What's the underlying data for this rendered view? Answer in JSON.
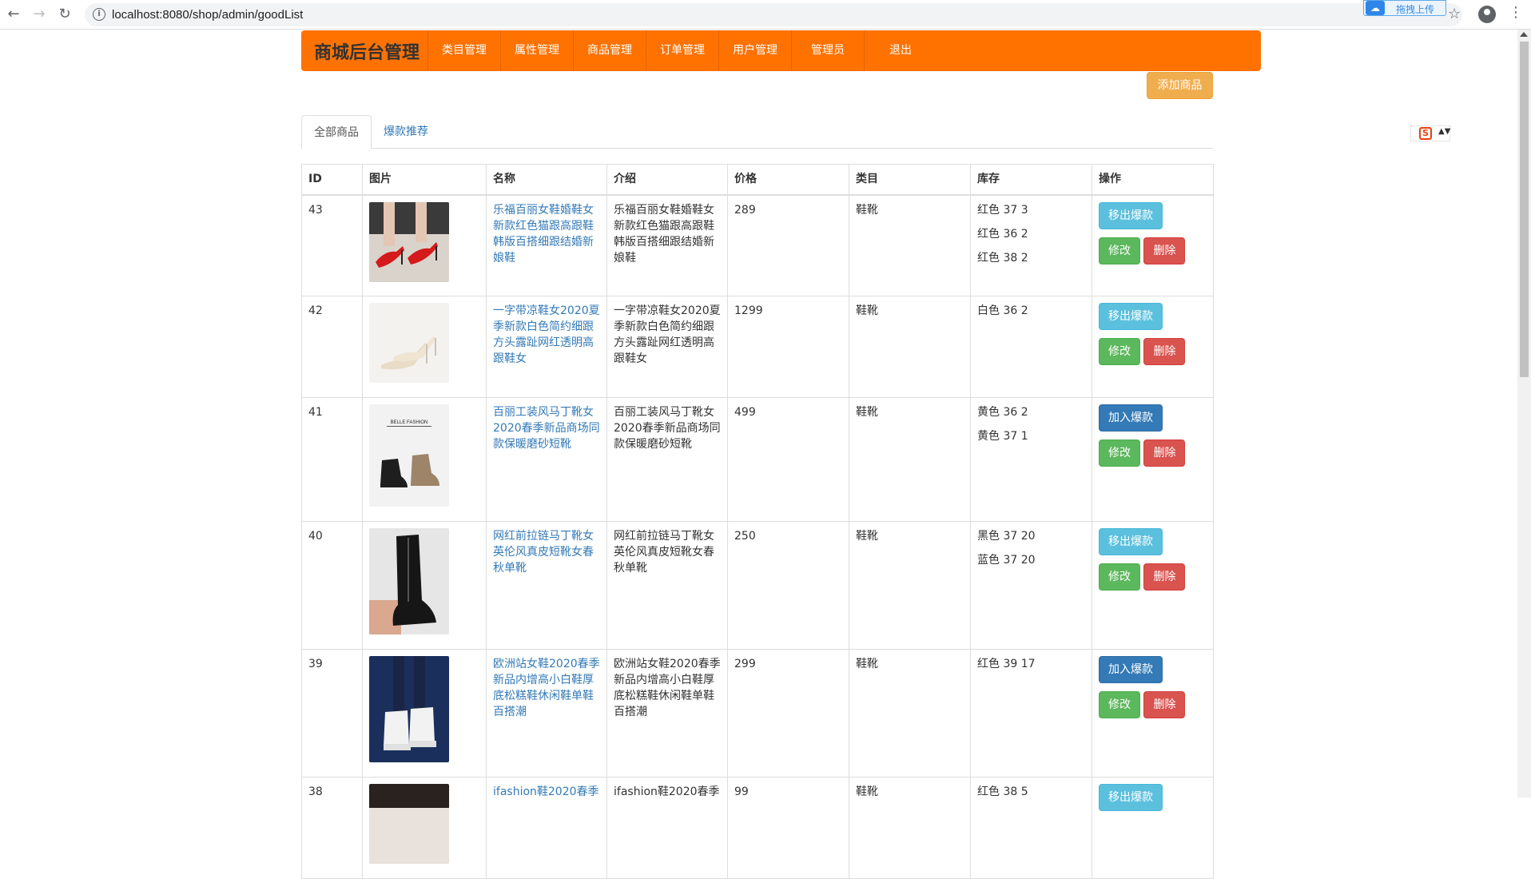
{
  "browser": {
    "url": "localhost:8080/shop/admin/goodList",
    "upload_ext_label": "拖拽上传"
  },
  "nav": {
    "brand": "商城后台管理",
    "items": [
      "类目管理",
      "属性管理",
      "商品管理",
      "订单管理",
      "用户管理",
      "管理员",
      "退出"
    ]
  },
  "add_button": "添加商品",
  "tabs": [
    "全部商品",
    "爆款推荐"
  ],
  "table": {
    "headers": [
      "ID",
      "图片",
      "名称",
      "介绍",
      "价格",
      "类目",
      "库存",
      "操作"
    ],
    "edit_label": "修改",
    "delete_label": "删除",
    "rows": [
      {
        "id": "43",
        "name": "乐福百丽女鞋婚鞋女新款红色猫跟高跟鞋韩版百搭细跟结婚新娘鞋",
        "intro": "乐福百丽女鞋婚鞋女新款红色猫跟高跟鞋韩版百搭细跟结婚新娘鞋",
        "price": "289",
        "category": "鞋靴",
        "stock": [
          "红色 37 3",
          "红色 36 2",
          "红色 38 2"
        ],
        "hot_label": "移出爆款",
        "hot_style": "info"
      },
      {
        "id": "42",
        "name": "一字带凉鞋女2020夏季新款白色简约细跟方头露趾网红透明高跟鞋女",
        "intro": "一字带凉鞋女2020夏季新款白色简约细跟方头露趾网红透明高跟鞋女",
        "price": "1299",
        "category": "鞋靴",
        "stock": [
          "白色 36 2"
        ],
        "hot_label": "移出爆款",
        "hot_style": "info"
      },
      {
        "id": "41",
        "name": "百丽工装风马丁靴女2020春季新品商场同款保暖磨砂短靴",
        "intro": "百丽工装风马丁靴女2020春季新品商场同款保暖磨砂短靴",
        "price": "499",
        "category": "鞋靴",
        "stock": [
          "黄色 36 2",
          "黄色 37 1"
        ],
        "hot_label": "加入爆款",
        "hot_style": "primary",
        "image_caption": "BELLE FASHION"
      },
      {
        "id": "40",
        "name": "网红前拉链马丁靴女英伦风真皮短靴女春秋单靴",
        "intro": "网红前拉链马丁靴女英伦风真皮短靴女春秋单靴",
        "price": "250",
        "category": "鞋靴",
        "stock": [
          "黑色 37 20",
          "蓝色 37 20"
        ],
        "hot_label": "移出爆款",
        "hot_style": "info"
      },
      {
        "id": "39",
        "name": "欧洲站女鞋2020春季新品内增高小白鞋厚底松糕鞋休闲鞋单鞋百搭潮",
        "intro": "欧洲站女鞋2020春季新品内增高小白鞋厚底松糕鞋休闲鞋单鞋百搭潮",
        "price": "299",
        "category": "鞋靴",
        "stock": [
          "红色 39 17"
        ],
        "hot_label": "加入爆款",
        "hot_style": "primary"
      },
      {
        "id": "38",
        "name": "ifashion鞋2020春季",
        "intro": "ifashion鞋2020春季",
        "price": "99",
        "category": "鞋靴",
        "stock": [
          "红色 38 5"
        ],
        "hot_label": "移出爆款",
        "hot_style": "info"
      }
    ]
  },
  "colors": {
    "nav_bg": "#ff7200",
    "link": "#337ab7",
    "info": "#5bc0de",
    "primary": "#337ab7",
    "success": "#5cb85c",
    "danger": "#d9534f",
    "warning": "#f0ad4e"
  }
}
